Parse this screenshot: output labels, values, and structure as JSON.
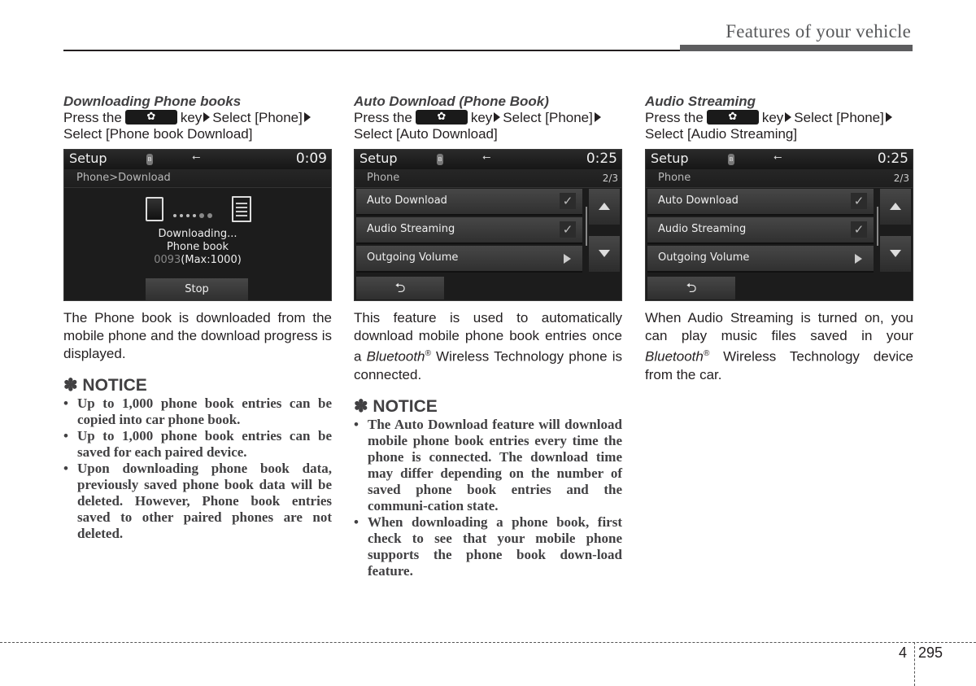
{
  "header": {
    "title": "Features of your vehicle"
  },
  "key_icon": "gear-icon",
  "sections": [
    {
      "title": "Downloading Phone books",
      "instr_pre": "Press the",
      "instr_key": "key",
      "instr_step1": "Select [Phone]",
      "instr_step2": "Select [Phone book Download]",
      "screen": {
        "title": "Setup",
        "time": "0:09",
        "breadcrumb": "Phone>Download",
        "status_line1": "Downloading...",
        "status_line2": "Phone book",
        "count": "0093",
        "max": "(Max:1000)",
        "stop_label": "Stop"
      },
      "body": "The Phone book is downloaded from the mobile phone and the download progress is displayed.",
      "notice": {
        "title": "✽ NOTICE",
        "items": [
          "Up to 1,000 phone book entries can be copied into car phone book.",
          "Up to 1,000 phone book entries can be saved for each paired device.",
          "Upon downloading phone book data, previously saved phone book data will be deleted. However, Phone book entries saved to other paired phones are not deleted."
        ]
      }
    },
    {
      "title": "Auto Download (Phone Book)",
      "instr_pre": "Press the",
      "instr_key": "key",
      "instr_step1": "Select [Phone]",
      "instr_step2": "Select [Auto Download]",
      "screen": {
        "title": "Setup",
        "time": "0:25",
        "breadcrumb": "Phone",
        "page": "2/3",
        "items": [
          {
            "label": "Auto Download",
            "checked": true
          },
          {
            "label": "Audio Streaming",
            "checked": true
          },
          {
            "label": "Outgoing Volume"
          }
        ],
        "back_label": "⮌"
      },
      "body_pre": "This feature is used to automatically download mobile phone book entries once a",
      "body_brand": "Bluetooth",
      "body_reg": "®",
      "body_post": " Wireless Technology phone is connected.",
      "notice": {
        "title": "✽ NOTICE",
        "items": [
          "The Auto Download feature will download mobile phone book entries every time the phone is connected. The download time may differ depending on the number of saved phone book entries and the communi-cation state.",
          "When downloading a phone book, first check to see that your mobile phone supports the phone book down-load feature."
        ]
      }
    },
    {
      "title": "Audio Streaming",
      "instr_pre": "Press the",
      "instr_key": "key",
      "instr_step1": "Select [Phone]",
      "instr_step2": "Select [Audio Streaming]",
      "screen": {
        "title": "Setup",
        "time": "0:25",
        "breadcrumb": "Phone",
        "page": "2/3",
        "items": [
          {
            "label": "Auto Download",
            "checked": true
          },
          {
            "label": "Audio Streaming",
            "checked": true
          },
          {
            "label": "Outgoing Volume"
          }
        ],
        "back_label": "⮌"
      },
      "body_pre": "When Audio Streaming is turned on, you can play music files saved in your ",
      "body_brand": "Bluetooth",
      "body_reg": "®",
      "body_post": " Wireless Technology device from the car."
    }
  ],
  "icons": {
    "check": "✓",
    "bullet": "•",
    "bt": "ʙ",
    "usb": "⭠"
  },
  "footer": {
    "chapter": "4",
    "page": "295"
  }
}
